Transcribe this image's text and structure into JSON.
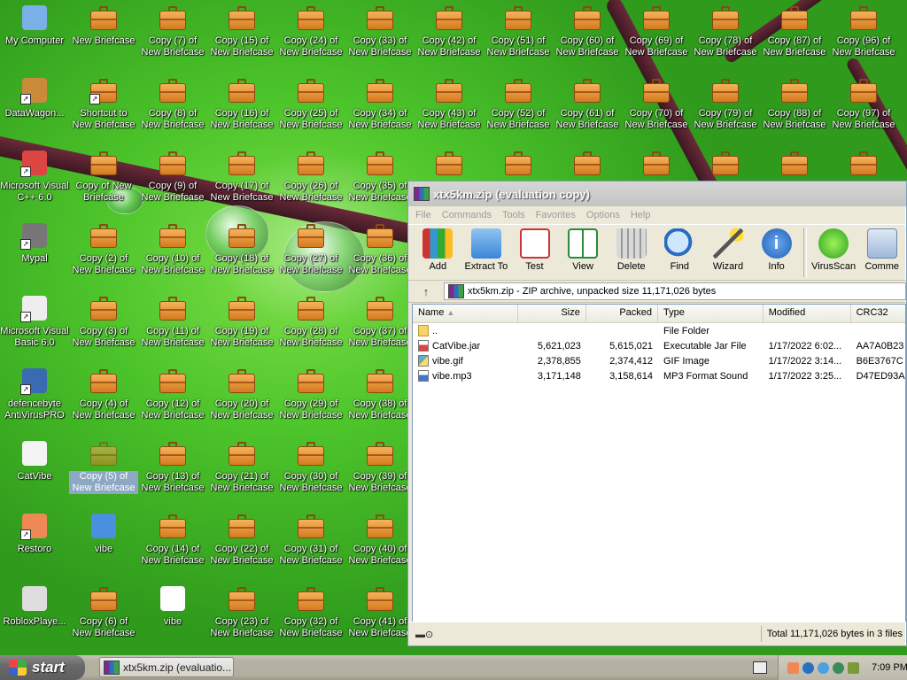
{
  "desktop": {
    "col0": [
      {
        "label": "My Computer",
        "icon": "computer-icon",
        "shortcut": false
      },
      {
        "label": "DataWagon...",
        "icon": "datawagon-icon",
        "shortcut": true
      },
      {
        "label": "Microsoft Visual C++ 6.0",
        "icon": "visual-cpp-icon",
        "shortcut": true
      },
      {
        "label": "Mypal",
        "icon": "mypal-icon",
        "shortcut": true
      },
      {
        "label": "Microsoft Visual Basic 6.0",
        "icon": "visual-basic-icon",
        "shortcut": true
      },
      {
        "label": "defencebyte AntiVirusPRO",
        "icon": "antivirus-icon",
        "shortcut": true
      },
      {
        "label": "CatVibe",
        "icon": "jar-file-icon",
        "shortcut": false
      },
      {
        "label": "Restoro",
        "icon": "restoro-icon",
        "shortcut": true
      },
      {
        "label": "RobloxPlaye...",
        "icon": "roblox-icon",
        "shortcut": false
      }
    ],
    "col1": [
      "New Briefcase",
      "Shortcut to New Briefcase",
      "Copy of New Briefcase",
      "Copy (2) of New Briefcase",
      "Copy (3) of New Briefcase",
      "Copy (4) of New Briefcase",
      "Copy (5) of New Briefcase",
      "vibe",
      "Copy (6) of New Briefcase"
    ],
    "col2": [
      "Copy (7) of New Briefcase",
      "Copy (8) of New Briefcase",
      "Copy (9) of New Briefcase",
      "Copy (10) of New Briefcase",
      "Copy (11) of New Briefcase",
      "Copy (12) of New Briefcase",
      "Copy (13) of New Briefcase",
      "Copy (14) of New Briefcase",
      "vibe"
    ],
    "col3": [
      "Copy (15) of New Briefcase",
      "Copy (16) of New Briefcase",
      "Copy (17) of New Briefcase",
      "Copy (18) of New Briefcase",
      "Copy (19) of New Briefcase",
      "Copy (20) of New Briefcase",
      "Copy (21) of New Briefcase",
      "Copy (22) of New Briefcase",
      "Copy (23) of New Briefcase"
    ],
    "col4": [
      "Copy (24) of New Briefcase",
      "Copy (25) of New Briefcase",
      "Copy (26) of New Briefcase",
      "Copy (27) of New Briefcase",
      "Copy (28) of New Briefcase",
      "Copy (29) of New Briefcase",
      "Copy (30) of New Briefcase",
      "Copy (31) of New Briefcase",
      "Copy (32) of New Briefcase"
    ],
    "col5": [
      "Copy (33) of New Briefcase",
      "Copy (34) of New Briefcase",
      "Copy (35) of New Briefcase",
      "Copy (36) of New Briefcase",
      "Copy (37) of New Briefcase",
      "Copy (38) of New Briefcase",
      "Copy (39) of New Briefcase",
      "Copy (40) of New Briefcase",
      "Copy (41) of New Briefcase"
    ],
    "top_rows": [
      [
        "Copy (42) of New Briefcase",
        "Copy (43) of New Briefcase"
      ],
      [
        "Copy (51) of New Briefcase",
        "Copy (52) of New Briefcase"
      ],
      [
        "Copy (60) of New Briefcase",
        "Copy (61) of New Briefcase"
      ],
      [
        "Copy (69) of New Briefcase",
        "Copy (70) of New Briefcase"
      ],
      [
        "Copy (78) of New Briefcase",
        "Copy (79) of New Briefcase"
      ],
      [
        "Copy (87) of New Briefcase",
        "Copy (88) of New Briefcase"
      ],
      [
        "Copy (96) of New Briefcase",
        "Copy (97) of New Briefcase"
      ]
    ],
    "selected": "Copy (5) of New Briefcase"
  },
  "winrar": {
    "title": "xtx5km.zip (evaluation copy)",
    "menu": [
      "File",
      "Commands",
      "Tools",
      "Favorites",
      "Options",
      "Help"
    ],
    "toolbar": [
      {
        "label": "Add",
        "icon": "add-archive-icon"
      },
      {
        "label": "Extract To",
        "icon": "extract-folder-icon"
      },
      {
        "label": "Test",
        "icon": "test-clipboard-icon"
      },
      {
        "label": "View",
        "icon": "view-book-icon"
      },
      {
        "label": "Delete",
        "icon": "trash-icon"
      },
      {
        "label": "Find",
        "icon": "magnifier-icon"
      },
      {
        "label": "Wizard",
        "icon": "wand-icon"
      },
      {
        "label": "Info",
        "icon": "info-icon"
      },
      {
        "label": "VirusScan",
        "icon": "virus-scan-icon"
      },
      {
        "label": "Comme",
        "icon": "comment-icon"
      }
    ],
    "path": "xtx5km.zip - ZIP archive, unpacked size 11,171,026 bytes",
    "columns": [
      "Name",
      "Size",
      "Packed",
      "Type",
      "Modified",
      "CRC32"
    ],
    "rows": [
      {
        "name": "..",
        "size": "",
        "packed": "",
        "type": "File Folder",
        "modified": "",
        "crc": "",
        "icon": "folder"
      },
      {
        "name": "CatVibe.jar",
        "size": "5,621,023",
        "packed": "5,615,021",
        "type": "Executable Jar File",
        "modified": "1/17/2022 6:02...",
        "crc": "AA7A0B23",
        "icon": "jar"
      },
      {
        "name": "vibe.gif",
        "size": "2,378,855",
        "packed": "2,374,412",
        "type": "GIF Image",
        "modified": "1/17/2022 3:14...",
        "crc": "B6E3767C",
        "icon": "gif"
      },
      {
        "name": "vibe.mp3",
        "size": "3,171,148",
        "packed": "3,158,614",
        "type": "MP3 Format Sound",
        "modified": "1/17/2022 3:25...",
        "crc": "D47ED93A",
        "icon": "mp3"
      }
    ],
    "status": "Total 11,171,026 bytes in 3 files"
  },
  "taskbar": {
    "start": "start",
    "task": "xtx5km.zip (evaluatio...",
    "clock": "7:09 PM"
  }
}
